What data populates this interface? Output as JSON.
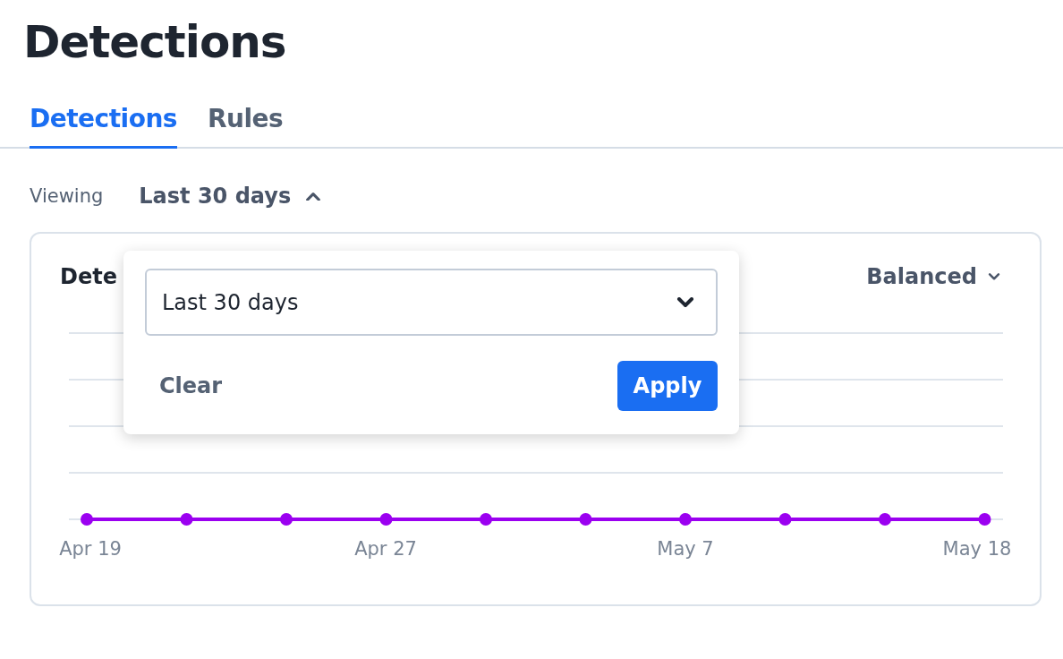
{
  "page": {
    "title": "Detections"
  },
  "tabs": [
    {
      "label": "Detections",
      "selected": true
    },
    {
      "label": "Rules",
      "selected": false
    }
  ],
  "filter": {
    "label": "Viewing",
    "value": "Last 30 days",
    "expanded": true
  },
  "card": {
    "title": "Dete",
    "mode": "Balanced",
    "x_labels": [
      "Apr 19",
      "Apr 27",
      "May 7",
      "May 18"
    ]
  },
  "popover": {
    "select_value": "Last 30 days",
    "clear": "Clear",
    "apply": "Apply"
  }
}
